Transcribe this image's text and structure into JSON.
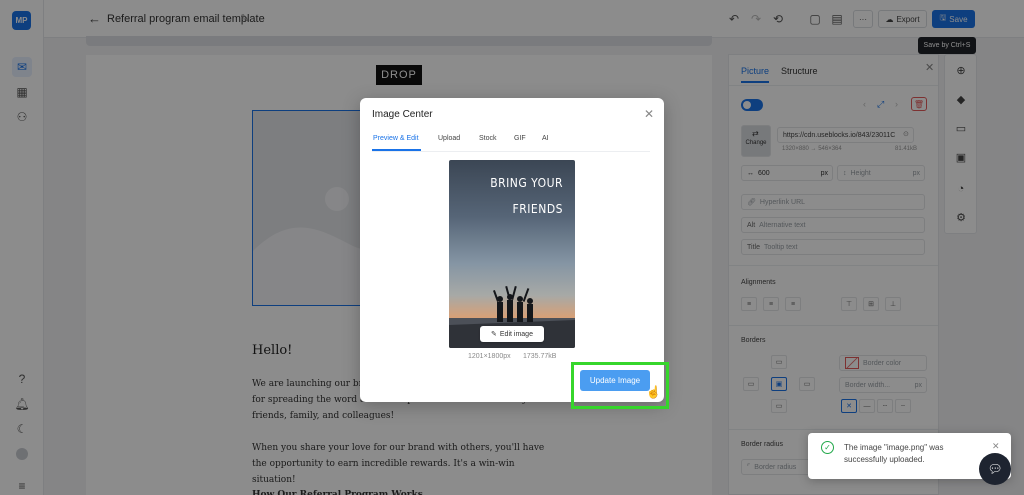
{
  "app": {
    "logo": "MP"
  },
  "header": {
    "title": "Referral program email template",
    "export_label": "Export",
    "save_label": "Save",
    "save_tooltip": "Save by Ctrl+S",
    "more_label": "···"
  },
  "email": {
    "logo_text": "DROP",
    "greeting": "Hello!",
    "paragraph1": "We are launching our brand new referral program to reward you for spreading the word about our products and services to your friends, family, and colleagues!",
    "paragraph2": "When you share your love for our brand with others, you'll have the opportunity to earn incredible rewards. It's a win-win situation!",
    "heading_partial": "How Our Referral Program Works"
  },
  "panel": {
    "tabs": [
      "Picture",
      "Structure"
    ],
    "url": "https://cdn.useblocks.io/843/23011C",
    "dims": "1320×880 → 546×364",
    "filesize": "81.41kB",
    "change_label": "Change",
    "width_value": "600",
    "width_unit": "px",
    "height_placeholder": "Height",
    "height_unit": "px",
    "hyperlink_placeholder": "Hyperlink URL",
    "alt_prefix": "Alt",
    "alt_placeholder": "Alternative text",
    "title_prefix": "Title",
    "title_placeholder": "Tooltip text",
    "alignments_label": "Alignments",
    "borders_label": "Borders",
    "border_color_placeholder": "Border color",
    "border_width_placeholder": "Border width...",
    "border_unit": "px",
    "border_radius_label": "Border radius",
    "border_radius_placeholder": "Border radius"
  },
  "modal": {
    "title": "Image Center",
    "tabs": [
      "Preview & Edit",
      "Upload",
      "Stock",
      "GIF",
      "AI"
    ],
    "preview_line1": "BRING YOUR",
    "preview_line2": "FRIENDS",
    "edit_label": "Edit image",
    "dimensions": "1201×1800px",
    "size": "1735.77kB",
    "update_label": "Update Image"
  },
  "toast": {
    "message": "The image \"image.png\" was successfully uploaded."
  },
  "icons": {
    "rail": [
      "mail-icon",
      "grid-icon",
      "users-icon",
      "help-icon",
      "bell-icon",
      "moon-icon",
      "avatar",
      "menu-icon"
    ],
    "right_tools": [
      "plus-circle-icon",
      "paint-bucket-icon",
      "chat-icon",
      "template-icon",
      "gauge-icon",
      "settings-icon"
    ]
  },
  "colors": {
    "accent": "#1a73e8",
    "highlight": "#36d62b",
    "success": "#22a84a"
  }
}
